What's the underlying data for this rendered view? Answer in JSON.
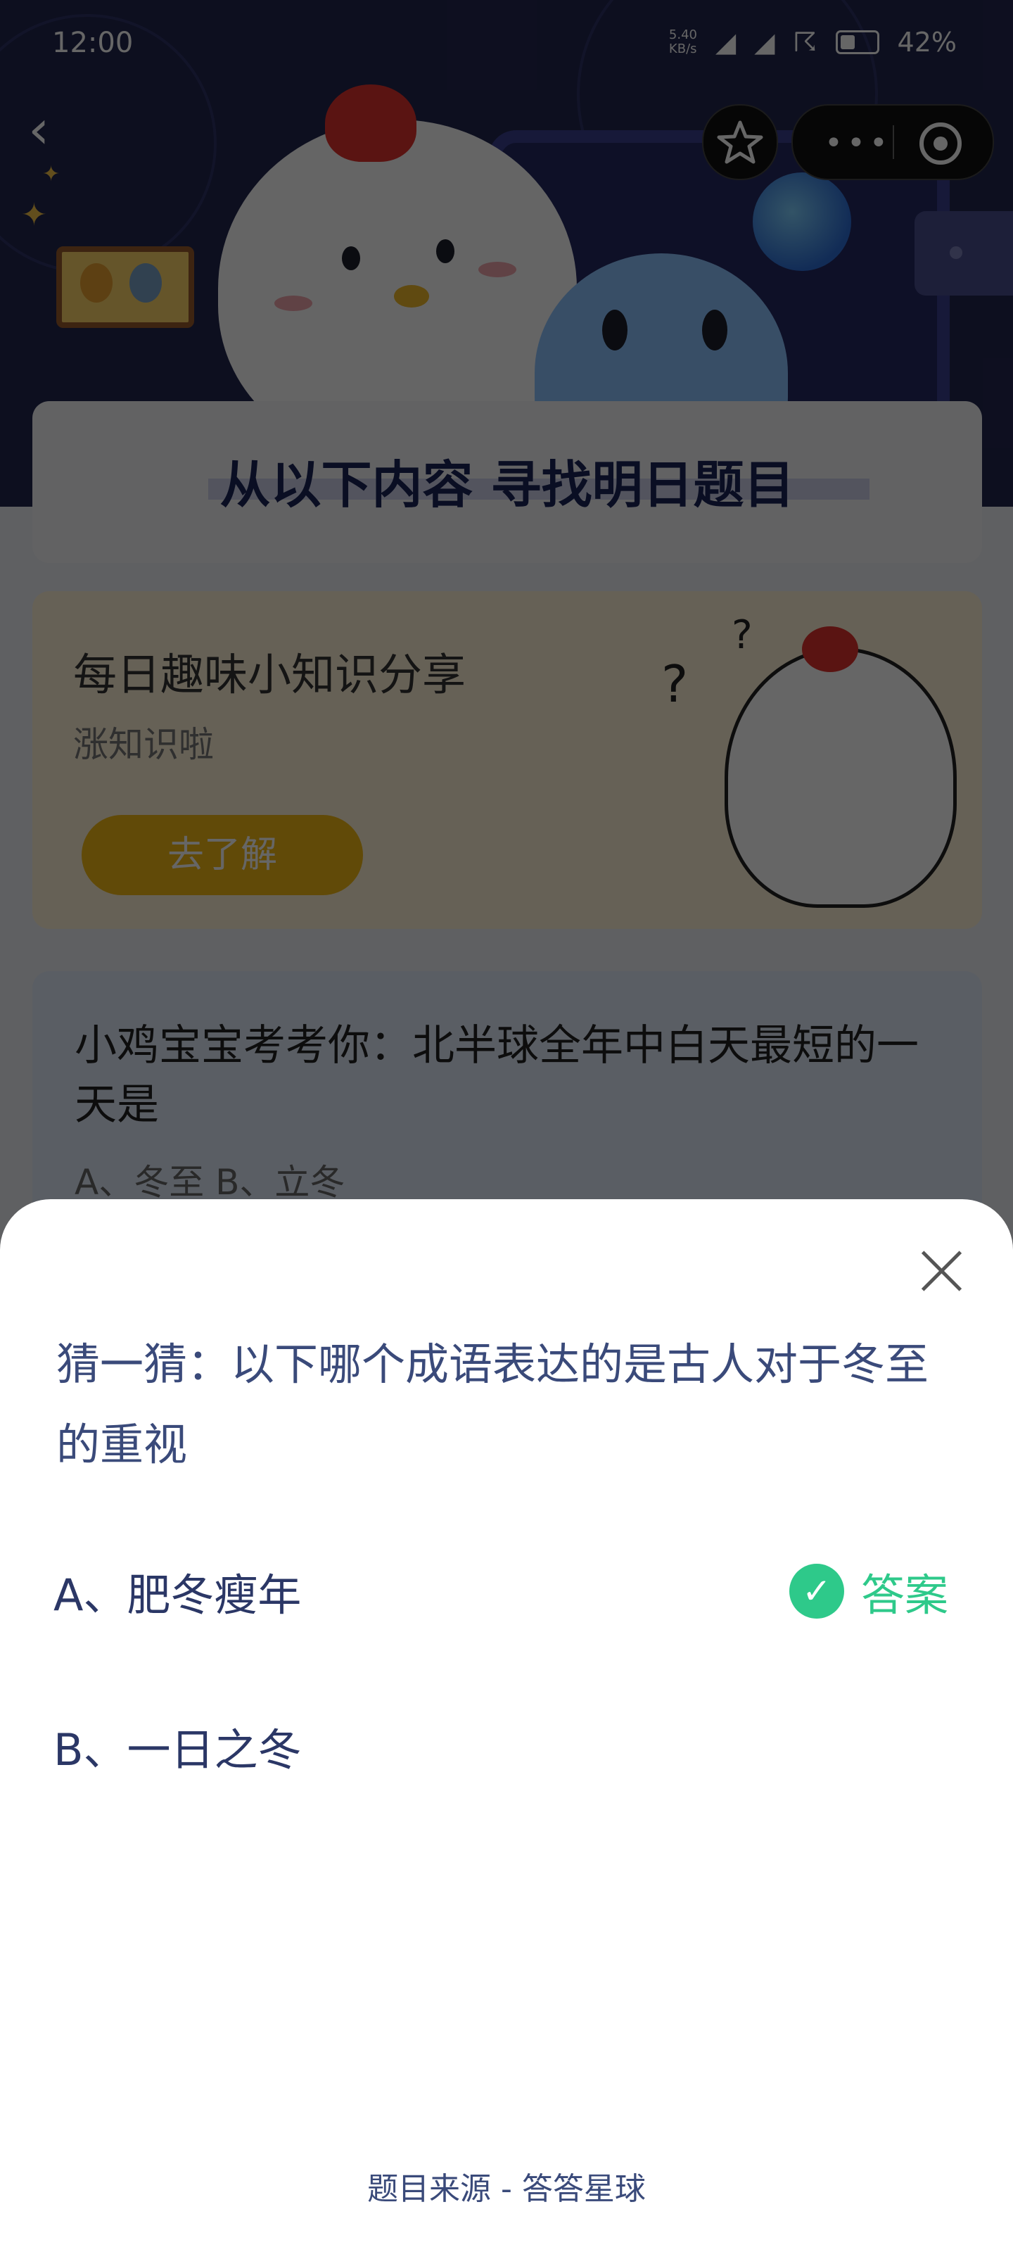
{
  "status_bar": {
    "time": "12:00",
    "net_speed_value": "5.40",
    "net_speed_unit": "KB/s",
    "battery": "42%"
  },
  "background": {
    "banner_title": "从以下内容  寻找明日题目",
    "tips_card": {
      "title": "每日趣味小知识分享",
      "subtitle": "涨知识啦",
      "button": "去了解"
    },
    "quiz_card": {
      "question": "小鸡宝宝考考你：北半球全年中白天最短的一天是",
      "options": "A、冬至    B、立冬"
    }
  },
  "sheet": {
    "question": "猜一猜：以下哪个成语表达的是古人对于冬至的重视",
    "options": [
      {
        "label": "A、肥冬瘦年"
      },
      {
        "label": "B、一日之冬"
      }
    ],
    "answer_label": "答案",
    "source": "题目来源 - 答答星球"
  },
  "colors": {
    "answer_green": "#2ec98a",
    "question_text": "#3a4a7a",
    "tips_button": "#f3b814"
  }
}
